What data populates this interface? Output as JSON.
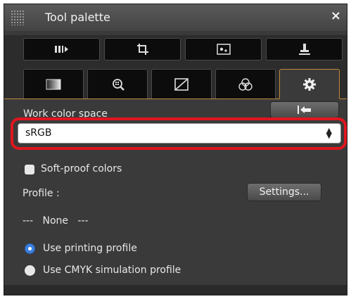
{
  "window": {
    "title": "Tool palette",
    "close_symbol": "×"
  },
  "toolbar_row1": [
    {
      "name": "basic-adjustment-icon"
    },
    {
      "name": "crop-icon"
    },
    {
      "name": "dust-delete-icon"
    },
    {
      "name": "stamp-icon"
    }
  ],
  "toolbar_row2": [
    {
      "name": "brightness-icon"
    },
    {
      "name": "lens-correction-icon"
    },
    {
      "name": "tone-curve-icon"
    },
    {
      "name": "color-adjustment-icon"
    },
    {
      "name": "gear-icon",
      "active": true
    }
  ],
  "work_color_space": {
    "label": "Work color space",
    "reset_icon": "revert-arrow-icon",
    "selected": "sRGB",
    "highlight_color": "#e0161e"
  },
  "soft_proof": {
    "checkbox_label": "Soft-proof colors",
    "checked": false,
    "profile_label": "Profile :",
    "settings_button": "Settings...",
    "profile_value": "---   None   ---",
    "options": [
      {
        "label": "Use printing profile",
        "selected": true
      },
      {
        "label": "Use CMYK simulation profile",
        "selected": false
      }
    ]
  },
  "accent_color": "#3b7fe0"
}
